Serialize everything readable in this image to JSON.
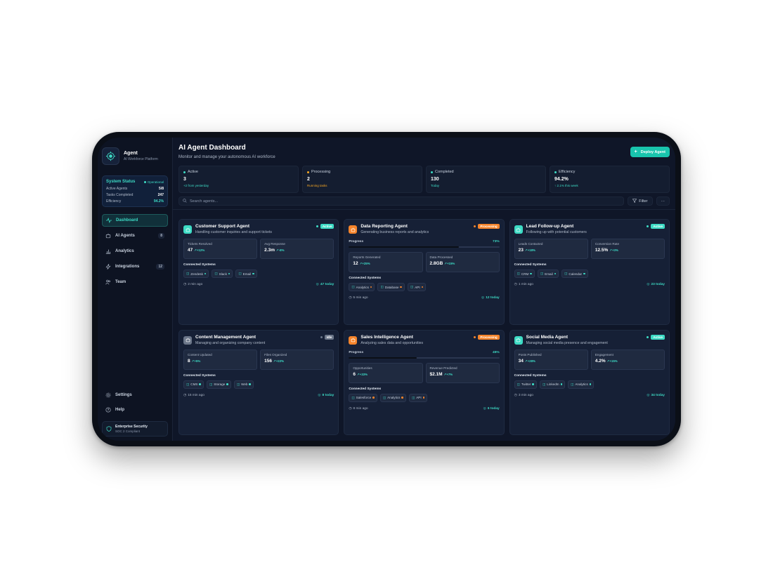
{
  "brand": {
    "name": "Agent",
    "subtitle": "AI Workforce Platform"
  },
  "system_status": {
    "title": "System Status",
    "state": "Operational",
    "rows": [
      {
        "label": "Active Agents",
        "value": "5/8"
      },
      {
        "label": "Tasks Completed",
        "value": "247"
      },
      {
        "label": "Efficiency",
        "value": "94.2%"
      }
    ]
  },
  "nav": {
    "items": [
      {
        "label": "Dashboard",
        "icon": "activity-icon",
        "count": ""
      },
      {
        "label": "AI Agents",
        "icon": "bot-icon",
        "count": "8"
      },
      {
        "label": "Analytics",
        "icon": "bar-chart-icon",
        "count": ""
      },
      {
        "label": "Integrations",
        "icon": "zap-icon",
        "count": "12"
      },
      {
        "label": "Team",
        "icon": "users-icon",
        "count": ""
      }
    ],
    "bottom": [
      {
        "label": "Settings",
        "icon": "gear-icon"
      },
      {
        "label": "Help",
        "icon": "help-icon"
      }
    ],
    "security": {
      "title": "Enterprise Security",
      "subtitle": "SOC 2 Compliant"
    }
  },
  "header": {
    "title": "AI Agent Dashboard",
    "subtitle": "Monitor and manage your autonomous AI workforce",
    "deploy_label": "Deploy Agent"
  },
  "stats": [
    {
      "label": "Active",
      "value": "3",
      "sub": "+2 from yesterday",
      "color": "#3ddbc5"
    },
    {
      "label": "Processing",
      "value": "2",
      "sub": "Running tasks",
      "color": "#f5a623"
    },
    {
      "label": "Completed",
      "value": "130",
      "sub": "Today",
      "color": "#3ddbc5"
    },
    {
      "label": "Efficiency",
      "value": "94.2%",
      "sub": "↑ 2.1% this week",
      "color": "#3ddbc5"
    }
  ],
  "toolbar": {
    "search_placeholder": "Search agents...",
    "filter_label": "Filter",
    "more_label": "···"
  },
  "connected_title": "Connected Systems",
  "progress_label": "Progress",
  "agents": [
    {
      "name": "Customer Support Agent",
      "description": "Handling customer inquiries and support tickets",
      "status": "Active",
      "metrics": [
        {
          "label": "Tickets Resolved",
          "value": "47",
          "delta": "+12%"
        },
        {
          "label": "Avg Response",
          "value": "2.3m",
          "delta": "-8%"
        }
      ],
      "systems": [
        "Zendesk",
        "Slack",
        "Email"
      ],
      "time": "2 min ago",
      "today": "47 today"
    },
    {
      "name": "Data Reporting Agent",
      "description": "Generating business reports and analytics",
      "status": "Processing",
      "progress": "73%",
      "progress_value": 0.73,
      "metrics": [
        {
          "label": "Reports Generated",
          "value": "12",
          "delta": "+25%"
        },
        {
          "label": "Data Processed",
          "value": "2.8GB",
          "delta": "+15%"
        }
      ],
      "systems": [
        "Analytics",
        "Database",
        "API"
      ],
      "time": "5 min ago",
      "today": "12 today"
    },
    {
      "name": "Lead Follow-up Agent",
      "description": "Following up with potential customers",
      "status": "Active",
      "metrics": [
        {
          "label": "Leads Contacted",
          "value": "23",
          "delta": "+18%"
        },
        {
          "label": "Conversion Rate",
          "value": "12.5%",
          "delta": "+3%"
        }
      ],
      "systems": [
        "CRM",
        "Email",
        "Calendar"
      ],
      "time": "1 min ago",
      "today": "23 today"
    },
    {
      "name": "Content Management Agent",
      "description": "Managing and organizing company content",
      "status": "Idle",
      "metrics": [
        {
          "label": "Content Updated",
          "value": "8",
          "delta": "+5%"
        },
        {
          "label": "Files Organized",
          "value": "156",
          "delta": "+22%"
        }
      ],
      "systems": [
        "CMS",
        "Storage",
        "Web"
      ],
      "time": "15 min ago",
      "today": "8 today"
    },
    {
      "name": "Sales Intelligence Agent",
      "description": "Analyzing sales data and opportunities",
      "status": "Processing",
      "progress": "45%",
      "progress_value": 0.45,
      "metrics": [
        {
          "label": "Opportunities",
          "value": "6",
          "delta": "+33%"
        },
        {
          "label": "Revenue Predicted",
          "value": "$2.1M",
          "delta": "+7%"
        }
      ],
      "systems": [
        "Salesforce",
        "Analytics",
        "API"
      ],
      "time": "8 min ago",
      "today": "6 today"
    },
    {
      "name": "Social Media Agent",
      "description": "Managing social media presence and engagement",
      "status": "Active",
      "metrics": [
        {
          "label": "Posts Published",
          "value": "34",
          "delta": "+28%"
        },
        {
          "label": "Engagement",
          "value": "4.2%",
          "delta": "+15%"
        }
      ],
      "systems": [
        "Twitter",
        "LinkedIn",
        "Analytics"
      ],
      "time": "3 min ago",
      "today": "34 today"
    }
  ],
  "colors": {
    "accent": "#19c4ad",
    "active": "#3ddbc5",
    "processing": "#f5842b",
    "idle": "#6b7689"
  }
}
